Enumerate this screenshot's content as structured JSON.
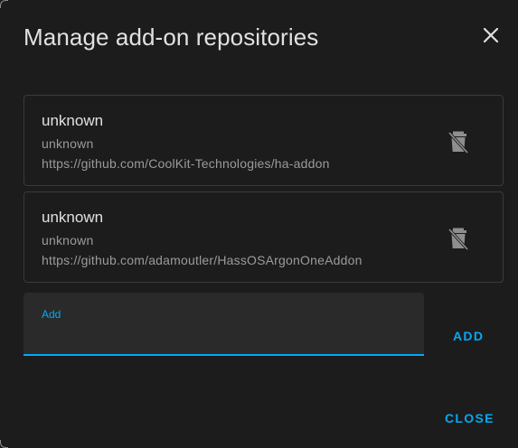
{
  "dialog": {
    "title": "Manage add-on repositories",
    "close_icon": "close-icon"
  },
  "repositories": [
    {
      "name": "unknown",
      "maintainer": "unknown",
      "url": "https://github.com/CoolKit-Technologies/ha-addon",
      "delete_icon": "delete-icon"
    },
    {
      "name": "unknown",
      "maintainer": "unknown",
      "url": "https://github.com/adamoutler/HassOSArgonOneAddon",
      "delete_icon": "delete-icon"
    }
  ],
  "add_field": {
    "label": "Add",
    "value": ""
  },
  "buttons": {
    "add": "ADD",
    "close": "CLOSE"
  },
  "colors": {
    "accent": "#03a9f4",
    "background": "#1c1c1c",
    "field_background": "#2a2a2a"
  }
}
